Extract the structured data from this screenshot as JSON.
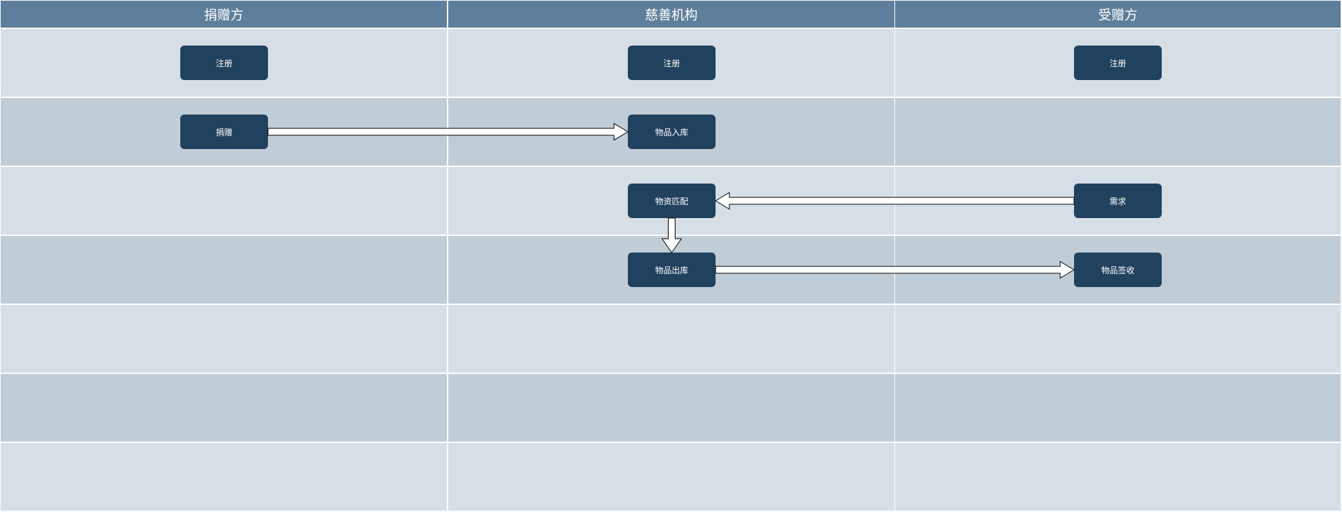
{
  "lanes": [
    {
      "id": "donor",
      "title": "捐赠方"
    },
    {
      "id": "charity",
      "title": "慈善机构"
    },
    {
      "id": "recipient",
      "title": "受赠方"
    }
  ],
  "row_count": 7,
  "colors": {
    "header_bg": "#5e7f9c",
    "row_light": "#d6dee6",
    "row_dark": "#c1cdd6",
    "node_bg": "#21425e",
    "node_text": "#ffffff",
    "arrow_fill": "#ffffff",
    "arrow_stroke": "#000000"
  },
  "nodes": [
    {
      "id": "donor-register",
      "lane": 0,
      "row": 0,
      "label": "注册"
    },
    {
      "id": "charity-register",
      "lane": 1,
      "row": 0,
      "label": "注册"
    },
    {
      "id": "recipient-register",
      "lane": 2,
      "row": 0,
      "label": "注册"
    },
    {
      "id": "donate",
      "lane": 0,
      "row": 1,
      "label": "捐赠"
    },
    {
      "id": "stock-in",
      "lane": 1,
      "row": 1,
      "label": "物品入库"
    },
    {
      "id": "match",
      "lane": 1,
      "row": 2,
      "label": "物资匹配"
    },
    {
      "id": "demand",
      "lane": 2,
      "row": 2,
      "label": "需求"
    },
    {
      "id": "stock-out",
      "lane": 1,
      "row": 3,
      "label": "物品出库"
    },
    {
      "id": "receive",
      "lane": 2,
      "row": 3,
      "label": "物品签收"
    }
  ],
  "edges": [
    {
      "from": "donate",
      "to": "stock-in"
    },
    {
      "from": "demand",
      "to": "match"
    },
    {
      "from": "match",
      "to": "stock-out"
    },
    {
      "from": "stock-out",
      "to": "receive"
    }
  ]
}
